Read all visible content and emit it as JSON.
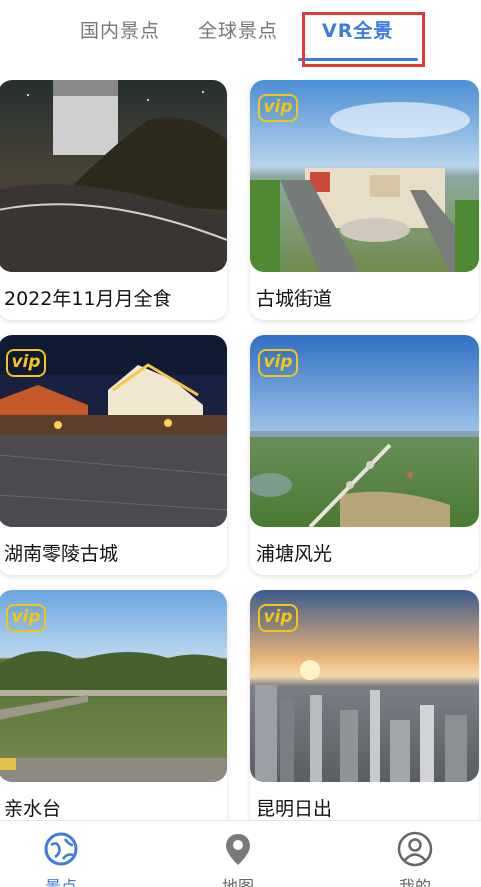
{
  "tabs": [
    {
      "label": "国内景点"
    },
    {
      "label": "全球景点"
    },
    {
      "label": "VR全景"
    }
  ],
  "badge_label": "vip",
  "cards": [
    {
      "title": "2022年11月月全食"
    },
    {
      "title": "古城街道"
    },
    {
      "title": "湖南零陵古城"
    },
    {
      "title": "浦塘风光"
    },
    {
      "title": "亲水台"
    },
    {
      "title": "昆明日出"
    }
  ],
  "bottom_nav": [
    {
      "label": "景点",
      "icon": "globe-icon"
    },
    {
      "label": "地图",
      "icon": "map-pin-icon"
    },
    {
      "label": "我的",
      "icon": "user-icon"
    }
  ],
  "colors": {
    "accent": "#3d7be0",
    "vip": "#f2c51a",
    "highlight": "#e03b3b"
  }
}
